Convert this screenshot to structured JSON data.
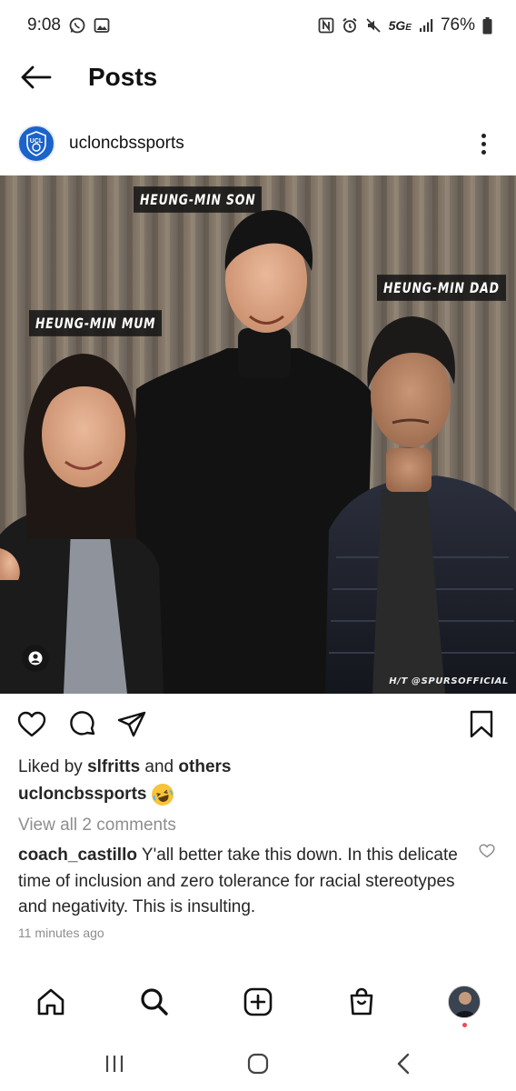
{
  "status_bar": {
    "time": "9:08",
    "network": "5G",
    "network_suffix": "E",
    "battery": "76%"
  },
  "header": {
    "title": "Posts"
  },
  "post": {
    "username": "ucloncbssports",
    "avatar_text": "UCL",
    "image": {
      "labels": {
        "son": "HEUNG-MIN SON",
        "mum": "HEUNG-MIN MUM",
        "dad": "HEUNG-MIN DAD"
      },
      "credit": "H/T @SPURSOFFICIAL"
    },
    "likes": {
      "prefix": "Liked by",
      "user": "slfritts",
      "connector": "and",
      "others": "others"
    },
    "caption_user": "ucloncbssports",
    "view_comments": "View all 2 comments",
    "comment": {
      "user": "coach_castillo",
      "text": "Y'all better take this down.  In this delicate time of inclusion and zero tolerance for racial stereotypes and negativity.  This is insulting."
    },
    "timestamp": "11 minutes ago"
  },
  "colors": {
    "accent_blue": "#1b63c9",
    "notification": "#ed4956",
    "muted_text": "#8e8e8e"
  }
}
